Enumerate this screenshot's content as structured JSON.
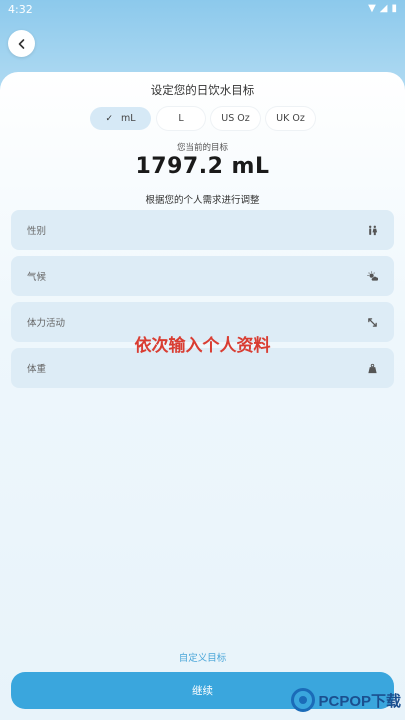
{
  "status_bar": {
    "time": "4:32"
  },
  "header": {
    "back_icon": "chevron-left-icon"
  },
  "sheet": {
    "title": "设定您的日饮水目标",
    "units": [
      {
        "label": "mL",
        "selected": true
      },
      {
        "label": "L",
        "selected": false
      },
      {
        "label": "US Oz",
        "selected": false
      },
      {
        "label": "UK Oz",
        "selected": false
      }
    ],
    "goal_label": "您当前的目标",
    "goal_value": "1797.2 mL",
    "adjust_label": "根据您的个人需求进行调整",
    "fields": [
      {
        "label": "性别",
        "icon": "gender-icon"
      },
      {
        "label": "气候",
        "icon": "weather-icon"
      },
      {
        "label": "体力活动",
        "icon": "activity-icon"
      },
      {
        "label": "体重",
        "icon": "weight-icon"
      }
    ],
    "annotation": "依次输入个人资料",
    "custom_link": "自定义目标",
    "continue_label": "继续"
  },
  "watermark": {
    "text": "PCPOP下载"
  },
  "colors": {
    "accent": "#3aa6dd",
    "link": "#4aa6d8",
    "annotation": "#d93d32"
  }
}
